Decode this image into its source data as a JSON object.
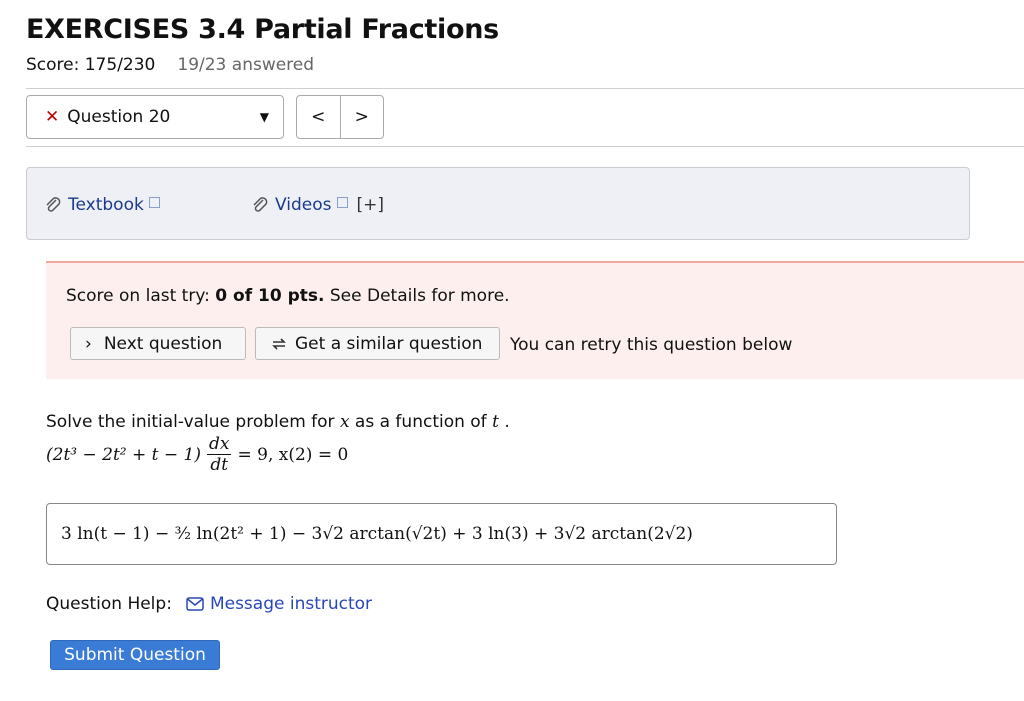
{
  "header": {
    "title": "EXERCISES 3.4 Partial Fractions",
    "score": "Score: 175/230",
    "answered": "19/23 answered"
  },
  "question_nav": {
    "selected": "Question 20",
    "status_mark": "✕",
    "prev_label": "<",
    "next_label": ">"
  },
  "resources": {
    "textbook": "Textbook",
    "videos": "Videos",
    "expand": "[+]"
  },
  "alert": {
    "prefix": "Score on last try: ",
    "score": "0 of 10 pts.",
    "suffix": " See Details for more.",
    "next_button": "Next question",
    "similar_button": "Get a similar question",
    "retry_text": "You can retry this question below"
  },
  "problem": {
    "text_before": "Solve the initial-value problem for ",
    "var_x": "x",
    "text_middle": " as a function of ",
    "var_t": "t",
    "text_after": " .",
    "eq_left": "(2t³ − 2t² + t − 1)",
    "eq_num": "dx",
    "eq_den": "dt",
    "eq_right": "= 9, x(2) = 0"
  },
  "answer": {
    "value": "3 ln(t − 1) − ³⁄₂ ln(2t² + 1) − 3√2 arctan(√2t) + 3 ln(3) + 3√2 arctan(2√2)"
  },
  "help": {
    "label": "Question Help:",
    "message": "Message instructor"
  },
  "submit": {
    "label": "Submit Question"
  },
  "colors": {
    "accent": "#3a7bd5",
    "link": "#2a47b8",
    "error": "#b00000",
    "alert_bg": "#fcefee"
  }
}
